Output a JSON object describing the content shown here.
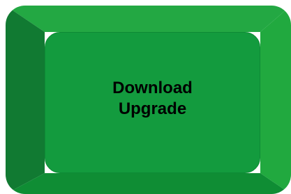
{
  "button": {
    "line1": "Download",
    "line2": "Upgrade"
  },
  "colors": {
    "top_bevel": "#23a843",
    "left_bevel": "#117a32",
    "right_bevel": "#21a93f",
    "bottom_bevel": "#0f8d34",
    "face": "#139b3e",
    "face_border": "#0d8a35",
    "text": "#000000"
  }
}
